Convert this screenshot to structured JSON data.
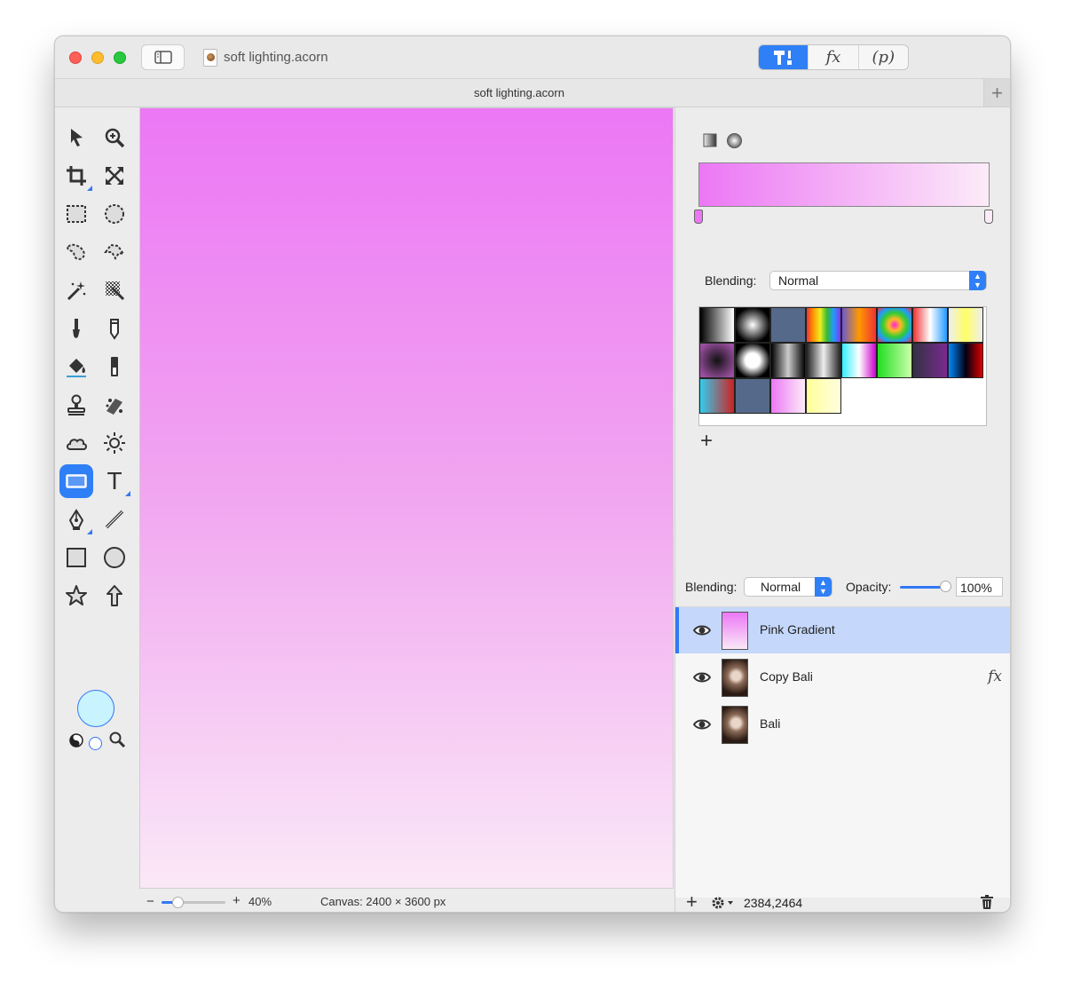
{
  "window": {
    "title": "soft lighting.acorn",
    "tab_title": "soft lighting.acorn",
    "tab_add": "+",
    "segments": [
      "tools",
      "fx",
      "p"
    ],
    "segment_labels": {
      "fx": "fx",
      "p": "(p)"
    }
  },
  "toolbar": {
    "tools": [
      "select-arrow-icon",
      "zoom-icon",
      "crop-icon",
      "transform-icon",
      "rect-select-icon",
      "ellipse-select-icon",
      "lasso-icon",
      "polygon-lasso-icon",
      "magic-wand-icon",
      "color-select-wand-icon",
      "brush-icon",
      "pencil-icon",
      "paint-bucket-icon",
      "eraser-icon",
      "clone-stamp-icon",
      "smudge-icon",
      "cloud-icon",
      "sun-icon",
      "gradient-icon",
      "text-icon",
      "pen-icon",
      "line-icon",
      "rectangle-shape-icon",
      "oval-shape-icon",
      "star-icon",
      "arrow-shape-icon"
    ],
    "active_tool": "gradient-icon",
    "text_tool_label": "T",
    "foreground_color": "#c9f3ff"
  },
  "canvas": {
    "gradient_top": "#ec77f5",
    "gradient_bottom": "#fae8f7"
  },
  "status": {
    "zoom_minus": "−",
    "zoom_plus": "+",
    "zoom_level": "40%",
    "canvas_size": "Canvas: 2400 × 3600 px"
  },
  "gradient_panel": {
    "blending_label": "Blending:",
    "blending_value": "Normal",
    "start_color": "#ec77f5",
    "end_color": "#fcebf8",
    "add_preset": "+"
  },
  "layers_panel": {
    "blending_label": "Blending:",
    "blending_value": "Normal",
    "opacity_label": "Opacity:",
    "opacity_value": "100%",
    "opacity": 1.0,
    "layers": [
      {
        "name": "Pink Gradient",
        "selected": true,
        "fx": ""
      },
      {
        "name": "Copy Bali",
        "selected": false,
        "fx": "fx"
      },
      {
        "name": "Bali",
        "selected": false,
        "fx": ""
      }
    ],
    "add_button": "+",
    "coordinates": "2384,2464"
  }
}
